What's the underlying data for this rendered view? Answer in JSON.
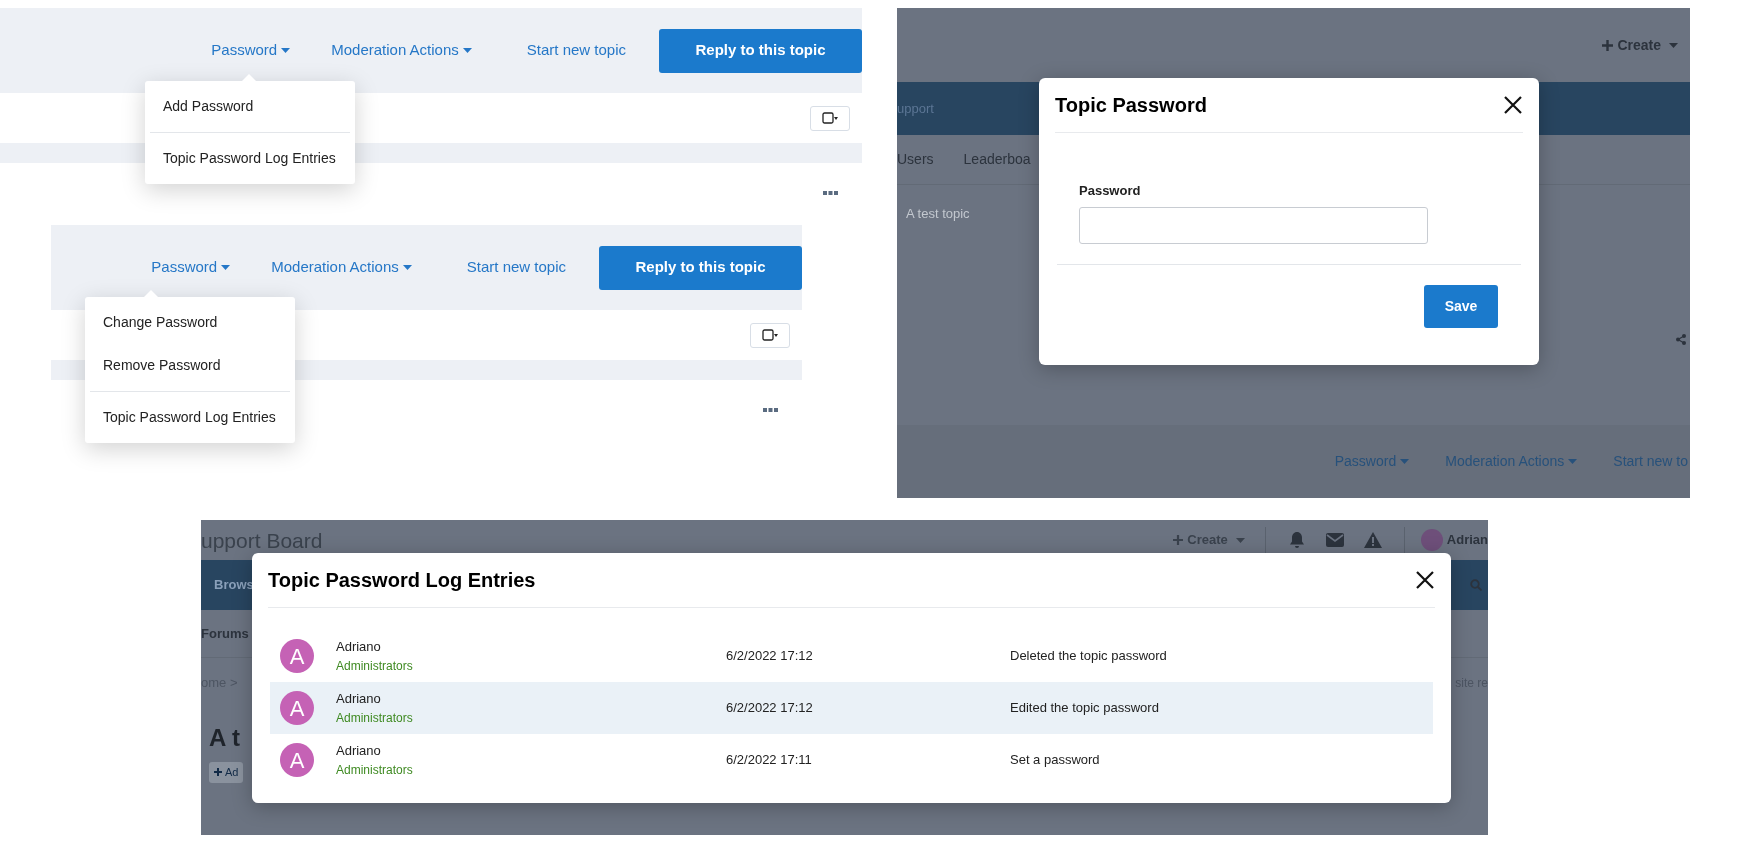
{
  "dropdown_views": [
    {
      "toolbar": {
        "password_menu": "Password",
        "moderation_menu": "Moderation Actions",
        "start_link": "Start new topic",
        "reply_button": "Reply to this topic"
      },
      "menu_groups": [
        [
          "Add Password"
        ],
        [
          "Topic Password Log Entries"
        ]
      ]
    },
    {
      "toolbar": {
        "password_menu": "Password",
        "moderation_menu": "Moderation Actions",
        "start_link": "Start new topic",
        "reply_button": "Reply to this topic"
      },
      "menu_groups": [
        [
          "Change Password",
          "Remove Password"
        ],
        [
          "Topic Password Log Entries"
        ]
      ]
    }
  ],
  "password_dialog": {
    "background": {
      "create_button": "Create",
      "nav_text": "upport",
      "tabs": [
        "Users",
        "Leaderboa"
      ],
      "breadcrumb": "A test topic",
      "toolbar": [
        "Password",
        "Moderation Actions",
        "Start new to"
      ]
    },
    "title": "Topic Password",
    "field_label": "Password",
    "save_button": "Save"
  },
  "log_dialog": {
    "background": {
      "site_title": "upport Board",
      "create_button": "Create",
      "user_name": "Adrian",
      "nav_tab": "Brows",
      "subnav": "Forums",
      "breadcrumb": "ome >",
      "page_title": "A t",
      "add_button": "Ad",
      "right_text": "site re"
    },
    "title": "Topic Password Log Entries",
    "entries": [
      {
        "avatar_letter": "A",
        "user": "Adriano",
        "group": "Administrators",
        "date": "6/2/2022 17:12",
        "action": "Deleted the topic password",
        "highlighted": false
      },
      {
        "avatar_letter": "A",
        "user": "Adriano",
        "group": "Administrators",
        "date": "6/2/2022 17:12",
        "action": "Edited the topic password",
        "highlighted": true
      },
      {
        "avatar_letter": "A",
        "user": "Adriano",
        "group": "Administrators",
        "date": "6/2/2022 17:11",
        "action": "Set a password",
        "highlighted": false
      }
    ]
  }
}
